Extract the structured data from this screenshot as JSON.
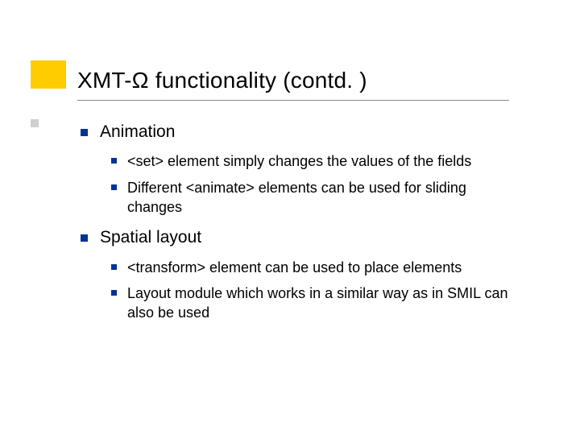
{
  "title": "XMT-Ω functionality (contd. )",
  "bullets": [
    {
      "label": "Animation",
      "items": [
        "<set> element simply changes the values of the fields",
        "Different <animate> elements can be used for sliding changes"
      ]
    },
    {
      "label": "Spatial layout",
      "items": [
        "<transform> element can be used to place elements",
        "Layout module which works in a similar way as in SMIL can also be used"
      ]
    }
  ]
}
